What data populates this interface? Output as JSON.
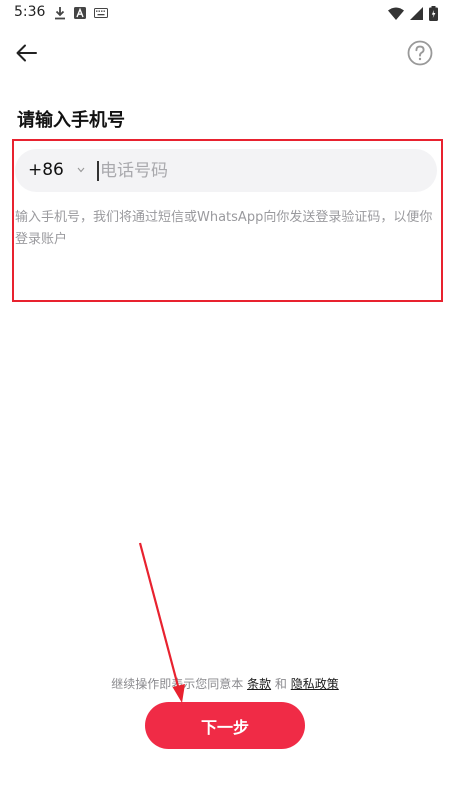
{
  "status_bar": {
    "time": "5:36",
    "left_icons": [
      "download-icon",
      "app-a-icon",
      "keyboard-icon"
    ],
    "right_icons": [
      "wifi-icon",
      "signal-icon",
      "battery-icon"
    ]
  },
  "header": {
    "back_icon": "arrow-left-icon",
    "help_icon": "question-circle-icon"
  },
  "page": {
    "title": "请输入手机号"
  },
  "phone_input": {
    "country_code": "+86",
    "value": "",
    "placeholder": "电话号码"
  },
  "hint": "输入手机号，我们将通过短信或WhatsApp向你发送登录验证码，以便你登录账户",
  "terms": {
    "prefix": "继续操作即表示您同意本",
    "terms_link": "条款",
    "connector": "和",
    "privacy_link": "隐私政策"
  },
  "next_button": {
    "label": "下一步"
  },
  "colors": {
    "accent": "#f02b46",
    "highlight": "#e8222f",
    "input_bg": "#f3f3f5",
    "hint": "#9a9a9e"
  }
}
